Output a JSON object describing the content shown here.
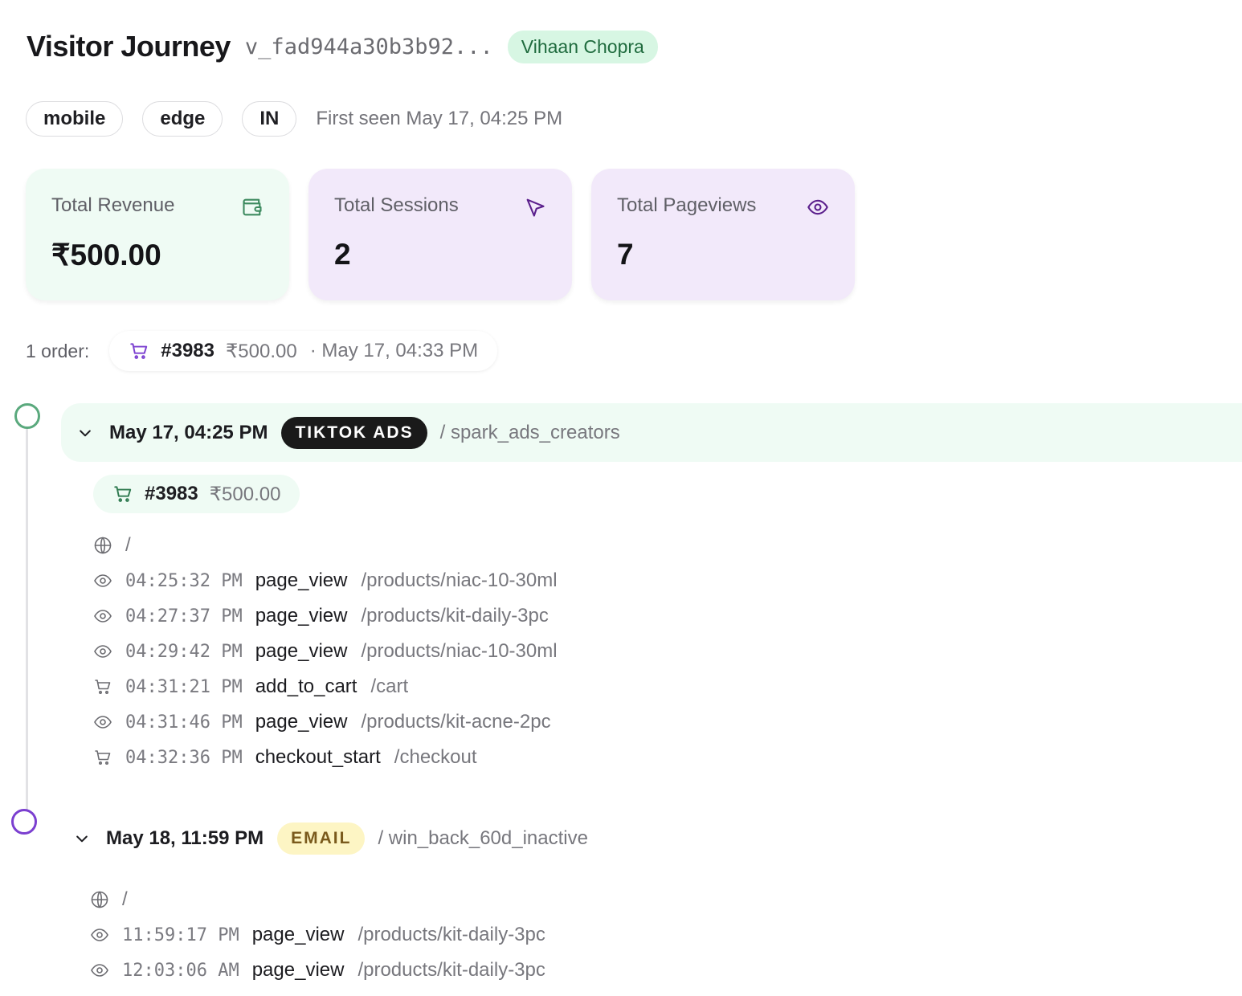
{
  "header": {
    "title": "Visitor Journey",
    "visitor_id": "v_fad944a30b3b92...",
    "visitor_name": "Vihaan Chopra"
  },
  "chips": [
    "mobile",
    "edge",
    "IN"
  ],
  "first_seen": "First seen May 17, 04:25 PM",
  "cards": [
    {
      "label": "Total Revenue",
      "value": "₹500.00",
      "icon": "wallet-icon"
    },
    {
      "label": "Total Sessions",
      "value": "2",
      "icon": "cursor-icon"
    },
    {
      "label": "Total Pageviews",
      "value": "7",
      "icon": "eye-icon"
    }
  ],
  "orders": {
    "label": "1 order:",
    "items": [
      {
        "number": "#3983",
        "amount": "₹500.00",
        "date": "· May 17, 04:33 PM"
      }
    ]
  },
  "sessions": [
    {
      "date": "May 17, 04:25 PM",
      "source": "TIKTOK ADS",
      "campaign": "/ spark_ads_creators",
      "order": {
        "number": "#3983",
        "amount": "₹500.00"
      },
      "landing": "/",
      "events": [
        {
          "icon": "eye-icon",
          "time": "04:25:32 PM",
          "name": "page_view",
          "path": "/products/niac-10-30ml"
        },
        {
          "icon": "eye-icon",
          "time": "04:27:37 PM",
          "name": "page_view",
          "path": "/products/kit-daily-3pc"
        },
        {
          "icon": "eye-icon",
          "time": "04:29:42 PM",
          "name": "page_view",
          "path": "/products/niac-10-30ml"
        },
        {
          "icon": "cart-icon",
          "time": "04:31:21 PM",
          "name": "add_to_cart",
          "path": "/cart"
        },
        {
          "icon": "eye-icon",
          "time": "04:31:46 PM",
          "name": "page_view",
          "path": "/products/kit-acne-2pc"
        },
        {
          "icon": "cart-icon",
          "time": "04:32:36 PM",
          "name": "checkout_start",
          "path": "/checkout"
        }
      ]
    },
    {
      "date": "May 18, 11:59 PM",
      "source": "EMAIL",
      "campaign": "/ win_back_60d_inactive",
      "landing": "/",
      "events": [
        {
          "icon": "eye-icon",
          "time": "11:59:17 PM",
          "name": "page_view",
          "path": "/products/kit-daily-3pc"
        },
        {
          "icon": "eye-icon",
          "time": "12:03:06 AM",
          "name": "page_view",
          "path": "/products/kit-daily-3pc"
        }
      ]
    }
  ],
  "colors": {
    "revenue_card": "#effbf4",
    "sessions_card": "#f2e9fa",
    "tiktok_badge": "#1a1a1a",
    "email_badge": "#fdf5c4",
    "name_badge": "#d7f6e3"
  }
}
